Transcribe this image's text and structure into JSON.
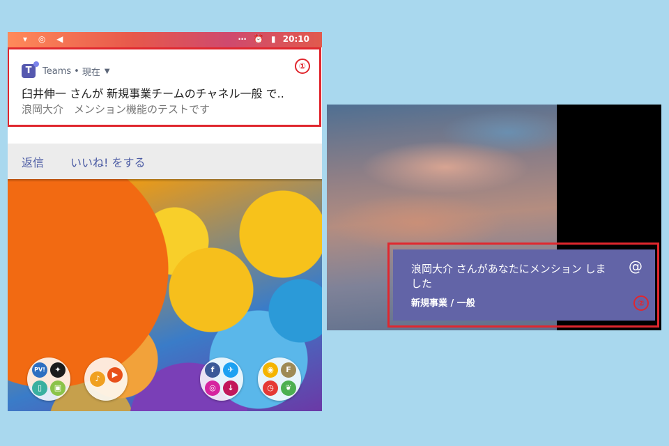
{
  "phone": {
    "status": {
      "time": "20:10"
    },
    "notification": {
      "app_name": "Teams",
      "separator": "•",
      "time_label": "現在",
      "title": "臼井伸一 さんが 新規事業チームのチャネル一般 で..",
      "body": "浪岡大介　メンション機能のテストです",
      "actions": [
        "返信",
        "いいね! をする"
      ],
      "marker": "①"
    },
    "apps": [
      {
        "dots": [
          {
            "icon": "pv-icon",
            "label": "PV!",
            "color": "#2d6fc1"
          },
          {
            "icon": "runner-icon",
            "label": "",
            "color": "#1c1c1c"
          },
          {
            "icon": "files-icon",
            "label": "",
            "color": "#3ab0a0"
          },
          {
            "icon": "android-icon",
            "label": "",
            "color": "#8bc34a"
          }
        ]
      },
      {
        "dots": [
          {
            "icon": "music-icon",
            "label": "",
            "color": "#f0a020"
          },
          {
            "icon": "video-icon",
            "label": "",
            "color": "#e8501a"
          }
        ]
      },
      {
        "dots": [
          {
            "icon": "facebook-icon",
            "label": "f",
            "color": "#3b5998"
          },
          {
            "icon": "twitter-icon",
            "label": "",
            "color": "#1da1f2"
          },
          {
            "icon": "instagram-icon",
            "label": "",
            "color": "#d6249f"
          },
          {
            "icon": "download-icon",
            "label": "",
            "color": "#c2185b"
          }
        ]
      },
      {
        "dots": [
          {
            "icon": "bulb-icon",
            "label": "",
            "color": "#f5b400"
          },
          {
            "icon": "file-icon",
            "label": "F",
            "color": "#9e8a55"
          },
          {
            "icon": "clock-icon",
            "label": "",
            "color": "#e53935"
          },
          {
            "icon": "leaf-icon",
            "label": "",
            "color": "#4caf50"
          }
        ]
      }
    ]
  },
  "desktop": {
    "toast": {
      "title": "浪岡大介 さんがあなたにメンション しました",
      "subtitle": "新規事業 / 一般",
      "mention_symbol": "@",
      "marker": "②"
    }
  },
  "colors": {
    "teams_purple": "#6264a7",
    "highlight_red": "#e0272e",
    "background": "#a9d8ee"
  }
}
